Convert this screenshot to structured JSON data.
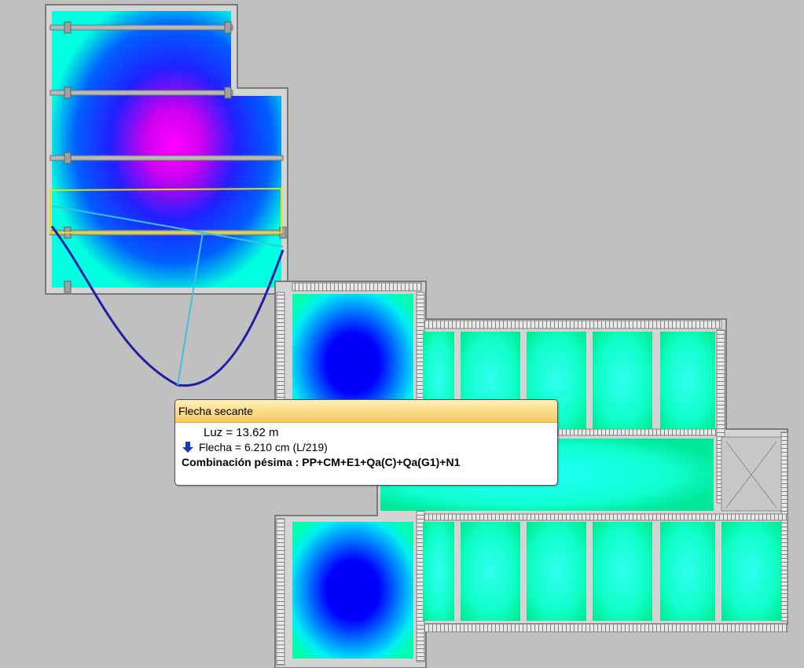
{
  "tooltip": {
    "title": "Flecha secante",
    "luz": "Luz = 13.62 m",
    "flecha": "Flecha = 6.210 cm (L/219)",
    "combinacion": "Combinación pésima : PP+CM+E1+Qa(C)+Qa(G1)+N1"
  },
  "icons": {
    "flecha_direction": "arrow-down-icon",
    "stair_void": "x-cross-icon"
  },
  "colors": {
    "background": "#c0c0c0",
    "deflection_max": "#ff00ff",
    "deflection_high": "#0000ff",
    "deflection_mid": "#00ffff",
    "deflection_low": "#00ee99",
    "deformed_curve": "#2020a0",
    "chord_line": "#40c0e0",
    "span_outline": "#e8e000"
  }
}
